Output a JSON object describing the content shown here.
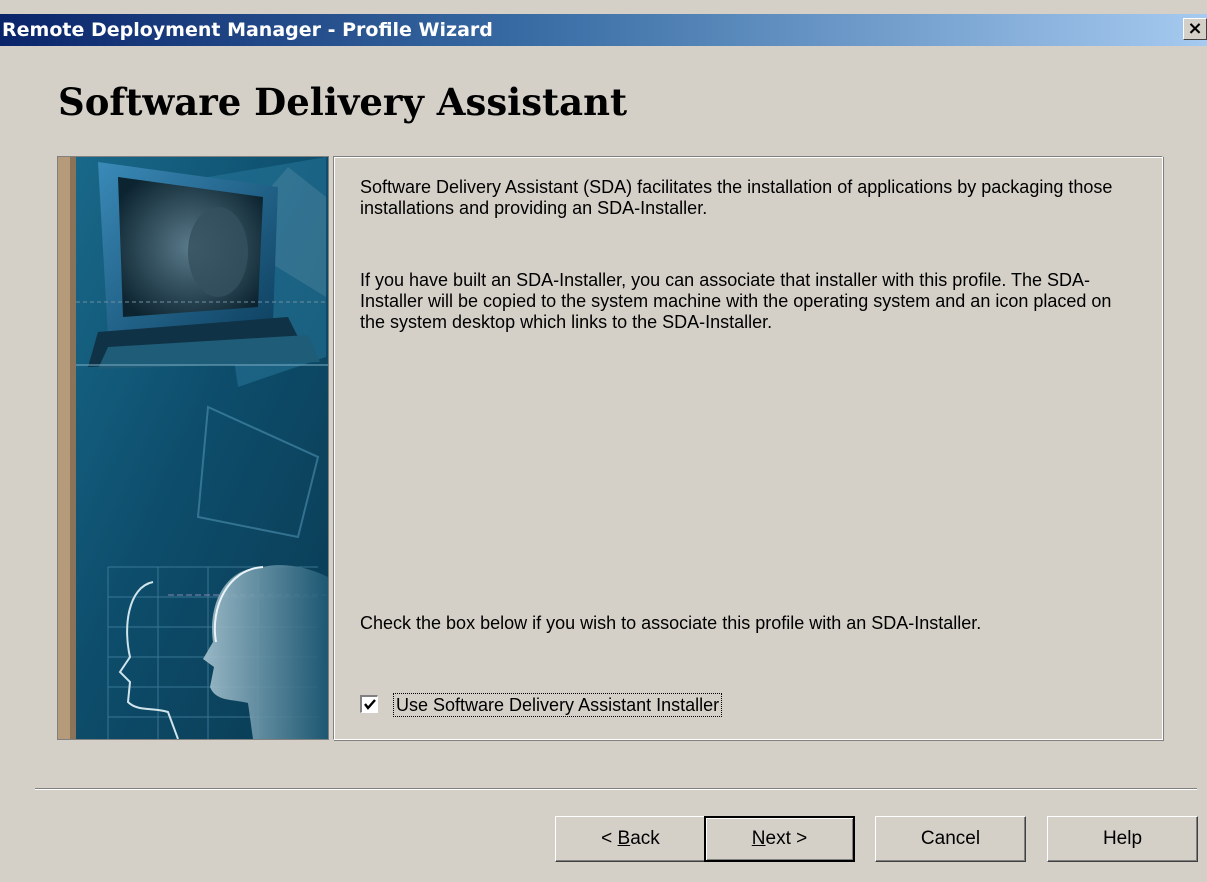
{
  "window": {
    "title": "Remote Deployment Manager - Profile Wizard",
    "close_label": "×"
  },
  "page": {
    "heading": "Software Delivery Assistant"
  },
  "content": {
    "paragraph1": "Software Delivery Assistant (SDA)  facilitates the installation of applications by packaging those installations and providing an SDA-Installer.",
    "paragraph2": "If you have built an SDA-Installer, you can associate that installer with this profile.  The SDA-Installer will be copied to the system machine with the operating system and an icon placed on the system desktop which links to the SDA-Installer.",
    "paragraph3": "Check the box below if you wish to associate this profile with an SDA-Installer.",
    "checkbox": {
      "label": "Use Software Delivery Assistant Installer",
      "checked": true
    }
  },
  "buttons": {
    "back_prefix": "< ",
    "back_mnemonic": "B",
    "back_rest": "ack",
    "next_mnemonic": "N",
    "next_rest": "ext >",
    "cancel": "Cancel",
    "help": "Help"
  },
  "colors": {
    "title_bar_start": "#0a246a",
    "title_bar_end": "#a6caf0",
    "dialog_face": "#d4d0c8",
    "banner_base": "#0e4a66"
  },
  "icons": {
    "close": "close-icon",
    "checkbox": "checkmark-icon",
    "banner": "wizard-banner-image"
  }
}
